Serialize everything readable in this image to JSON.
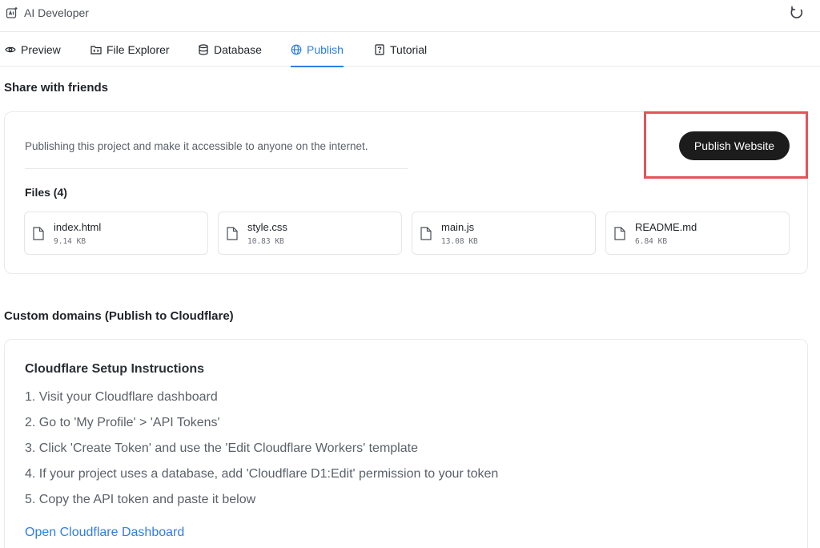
{
  "app": {
    "title": "AI Developer"
  },
  "tabs": [
    {
      "label": "Preview",
      "icon": "eye-icon"
    },
    {
      "label": "File Explorer",
      "icon": "folder-code-icon"
    },
    {
      "label": "Database",
      "icon": "database-icon"
    },
    {
      "label": "Publish",
      "icon": "globe-icon",
      "active": true
    },
    {
      "label": "Tutorial",
      "icon": "help-square-icon"
    }
  ],
  "share": {
    "title": "Share with friends",
    "description": "Publishing this project and make it accessible to anyone on the internet.",
    "publish_button": "Publish Website",
    "files_title": "Files (4)",
    "files": [
      {
        "name": "index.html",
        "size": "9.14 KB"
      },
      {
        "name": "style.css",
        "size": "10.83 KB"
      },
      {
        "name": "main.js",
        "size": "13.08 KB"
      },
      {
        "name": "README.md",
        "size": "6.84 KB"
      }
    ]
  },
  "custom_domains": {
    "title": "Custom domains (Publish to Cloudflare)",
    "setup_title": "Cloudflare Setup Instructions",
    "steps": [
      "1. Visit your Cloudflare dashboard",
      "2. Go to 'My Profile' > 'API Tokens'",
      "3. Click 'Create Token' and use the 'Edit Cloudflare Workers' template",
      "4. If your project uses a database, add 'Cloudflare D1:Edit' permission to your token",
      "5. Copy the API token and paste it below"
    ],
    "link": "Open Cloudflare Dashboard"
  },
  "colors": {
    "accent": "#2f7ee6",
    "button_bg": "#1c1c1c",
    "highlight": "#e4535a"
  }
}
